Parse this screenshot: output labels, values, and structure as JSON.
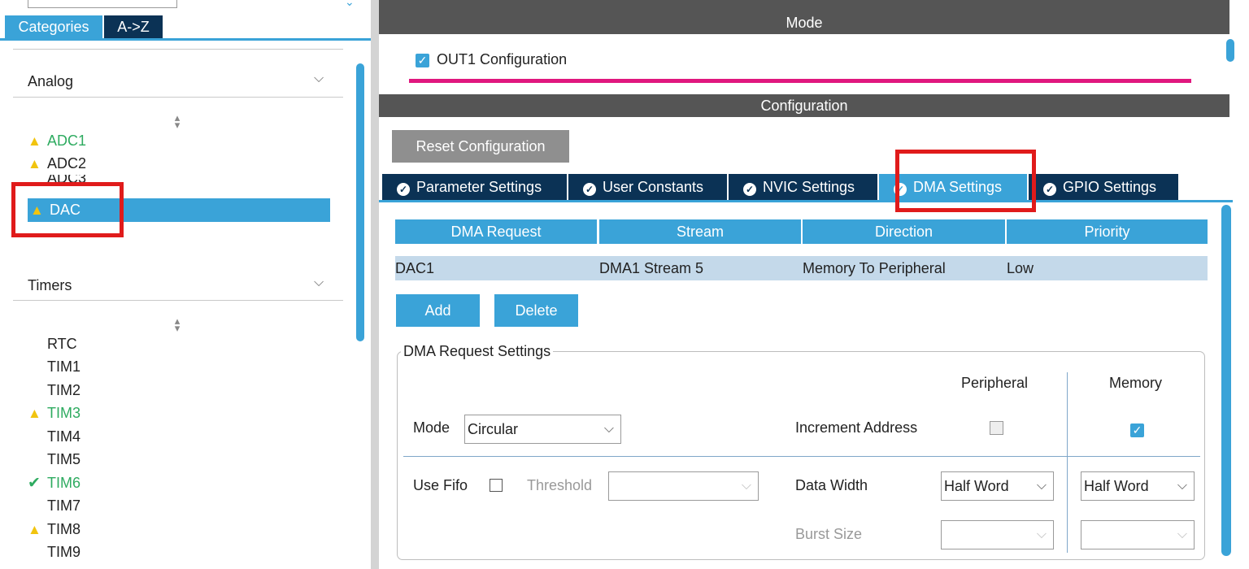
{
  "left_panel": {
    "tabs": {
      "categories": "Categories",
      "az": "A->Z"
    },
    "sections": [
      {
        "title": "Analog"
      },
      {
        "title": "Timers"
      }
    ],
    "analog_items": [
      {
        "label": "ADC1",
        "status": "warning",
        "color": "#2eab60"
      },
      {
        "label": "ADC2",
        "status": "warning",
        "color": "#222222"
      },
      {
        "label": "ADC3",
        "status": "none",
        "color": "#222222"
      },
      {
        "label": "DAC",
        "status": "warning",
        "selected": true
      }
    ],
    "timer_items": [
      {
        "label": "RTC",
        "status": "none"
      },
      {
        "label": "TIM1",
        "status": "none"
      },
      {
        "label": "TIM2",
        "status": "none"
      },
      {
        "label": "TIM3",
        "status": "warning",
        "color": "#2eab60"
      },
      {
        "label": "TIM4",
        "status": "none"
      },
      {
        "label": "TIM5",
        "status": "none"
      },
      {
        "label": "TIM6",
        "status": "ok",
        "color": "#2eab60"
      },
      {
        "label": "TIM7",
        "status": "none"
      },
      {
        "label": "TIM8",
        "status": "warning"
      },
      {
        "label": "TIM9",
        "status": "none"
      }
    ]
  },
  "mode": {
    "header": "Mode",
    "out1_label": "OUT1 Configuration",
    "out1_checked": true
  },
  "configuration": {
    "header": "Configuration",
    "reset_button": "Reset Configuration",
    "tabs": [
      {
        "label": "Parameter Settings",
        "active": false
      },
      {
        "label": "User Constants",
        "active": false
      },
      {
        "label": "NVIC Settings",
        "active": false
      },
      {
        "label": "DMA Settings",
        "active": true
      },
      {
        "label": "GPIO Settings",
        "active": false
      }
    ]
  },
  "dma_table": {
    "columns": [
      "DMA Request",
      "Stream",
      "Direction",
      "Priority"
    ],
    "rows": [
      [
        "DAC1",
        "DMA1 Stream 5",
        "Memory To Peripheral",
        "Low"
      ]
    ],
    "add_button": "Add",
    "delete_button": "Delete"
  },
  "dma_request_settings": {
    "legend": "DMA Request Settings",
    "peripheral_header": "Peripheral",
    "memory_header": "Memory",
    "mode_label": "Mode",
    "mode_value": "Circular",
    "increment_address_label": "Increment Address",
    "peripheral_increment": false,
    "memory_increment": true,
    "use_fifo_label": "Use Fifo",
    "use_fifo_checked": false,
    "threshold_label": "Threshold",
    "threshold_value": "",
    "data_width_label": "Data Width",
    "peripheral_data_width": "Half Word",
    "memory_data_width": "Half Word",
    "burst_size_label": "Burst Size",
    "peripheral_burst_size": "",
    "memory_burst_size": ""
  },
  "colors": {
    "accent_blue": "#3aa3d8",
    "dark_navy": "#0b3255",
    "header_grey": "#555555",
    "highlight_red": "#e01b1b",
    "magenta_line": "#e0177e",
    "status_green": "#2eab60",
    "warning_yellow": "#f1c40f"
  },
  "icons": {
    "warning": "warning-icon",
    "ok": "checkmark-icon",
    "tab_check": "check-circle-icon",
    "dropdown": "chevron-down-icon",
    "sort": "sort-arrows-icon"
  }
}
